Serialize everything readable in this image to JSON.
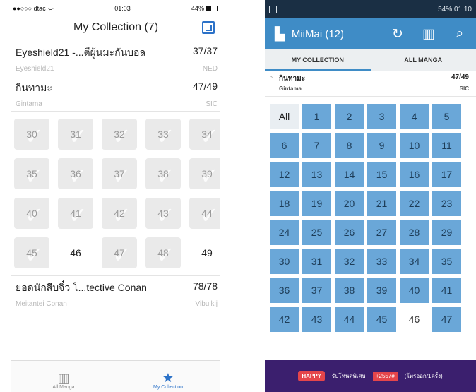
{
  "ios": {
    "status": {
      "carrier": "●●○○○ dtac",
      "wifi": "ᯤ",
      "time": "01:03",
      "battery": "44%"
    },
    "nav_title": "My Collection (7)",
    "series": [
      {
        "title": "Eyeshield21 -...ตีผู้นมะกันบอล",
        "count": "37/37",
        "subtitle": "Eyeshield21",
        "publisher": "NED"
      },
      {
        "title": "กินทามะ",
        "count": "47/49",
        "subtitle": "Gintama",
        "publisher": "SIC"
      }
    ],
    "volumes": [
      {
        "n": "30",
        "have": true
      },
      {
        "n": "31",
        "have": true
      },
      {
        "n": "32",
        "have": true
      },
      {
        "n": "33",
        "have": true
      },
      {
        "n": "34",
        "have": true
      },
      {
        "n": "35",
        "have": true
      },
      {
        "n": "36",
        "have": true
      },
      {
        "n": "37",
        "have": true
      },
      {
        "n": "38",
        "have": true
      },
      {
        "n": "39",
        "have": true
      },
      {
        "n": "40",
        "have": true
      },
      {
        "n": "41",
        "have": true
      },
      {
        "n": "42",
        "have": true
      },
      {
        "n": "43",
        "have": true
      },
      {
        "n": "44",
        "have": true
      },
      {
        "n": "45",
        "have": true
      },
      {
        "n": "46",
        "have": false
      },
      {
        "n": "47",
        "have": true
      },
      {
        "n": "48",
        "have": true
      },
      {
        "n": "49",
        "have": false
      }
    ],
    "series_bottom": {
      "title": "ยอดนักสืบจิ๋ว โ...tective Conan",
      "count": "78/78",
      "subtitle": "Meitantei Conan",
      "publisher": "Vibulkij"
    },
    "tabs": [
      {
        "label": "All Manga",
        "icon": "books-icon"
      },
      {
        "label": "My Collection",
        "icon": "star-icon"
      }
    ]
  },
  "android": {
    "status": {
      "time": "01:10",
      "battery": "54%"
    },
    "app_title": "MiiMai (12)",
    "tabs": [
      "MY COLLECTION",
      "ALL MANGA"
    ],
    "series": {
      "title": "กินทามะ",
      "count": "47/49",
      "subtitle": "Gintama",
      "publisher": "SIC"
    },
    "all_label": "All",
    "volumes": [
      {
        "n": "1",
        "have": true
      },
      {
        "n": "2",
        "have": true
      },
      {
        "n": "3",
        "have": true
      },
      {
        "n": "4",
        "have": true
      },
      {
        "n": "5",
        "have": true
      },
      {
        "n": "6",
        "have": true
      },
      {
        "n": "7",
        "have": true
      },
      {
        "n": "8",
        "have": true
      },
      {
        "n": "9",
        "have": true
      },
      {
        "n": "10",
        "have": true
      },
      {
        "n": "11",
        "have": true
      },
      {
        "n": "12",
        "have": true
      },
      {
        "n": "13",
        "have": true
      },
      {
        "n": "14",
        "have": true
      },
      {
        "n": "15",
        "have": true
      },
      {
        "n": "16",
        "have": true
      },
      {
        "n": "17",
        "have": true
      },
      {
        "n": "18",
        "have": true
      },
      {
        "n": "19",
        "have": true
      },
      {
        "n": "20",
        "have": true
      },
      {
        "n": "21",
        "have": true
      },
      {
        "n": "22",
        "have": true
      },
      {
        "n": "23",
        "have": true
      },
      {
        "n": "24",
        "have": true
      },
      {
        "n": "25",
        "have": true
      },
      {
        "n": "26",
        "have": true
      },
      {
        "n": "27",
        "have": true
      },
      {
        "n": "28",
        "have": true
      },
      {
        "n": "29",
        "have": true
      },
      {
        "n": "30",
        "have": true
      },
      {
        "n": "31",
        "have": true
      },
      {
        "n": "32",
        "have": true
      },
      {
        "n": "33",
        "have": true
      },
      {
        "n": "34",
        "have": true
      },
      {
        "n": "35",
        "have": true
      },
      {
        "n": "36",
        "have": true
      },
      {
        "n": "37",
        "have": true
      },
      {
        "n": "38",
        "have": true
      },
      {
        "n": "39",
        "have": true
      },
      {
        "n": "40",
        "have": true
      },
      {
        "n": "41",
        "have": true
      },
      {
        "n": "42",
        "have": true
      },
      {
        "n": "43",
        "have": true
      },
      {
        "n": "44",
        "have": true
      },
      {
        "n": "45",
        "have": true
      },
      {
        "n": "46",
        "have": false
      },
      {
        "n": "47",
        "have": true
      }
    ],
    "ad": {
      "badge": "HAPPY",
      "headline": "รับโหนดพิเศษ",
      "promo": "+2557#",
      "footer": "(โทรออก/1ครั้ง)"
    },
    "colors": {
      "accent": "#3f8cc6",
      "tile": "#6aa7d8",
      "status_bar": "#1a2f44"
    },
    "icons": [
      "book-icon",
      "refresh-icon",
      "barcode-icon",
      "search-icon"
    ]
  }
}
